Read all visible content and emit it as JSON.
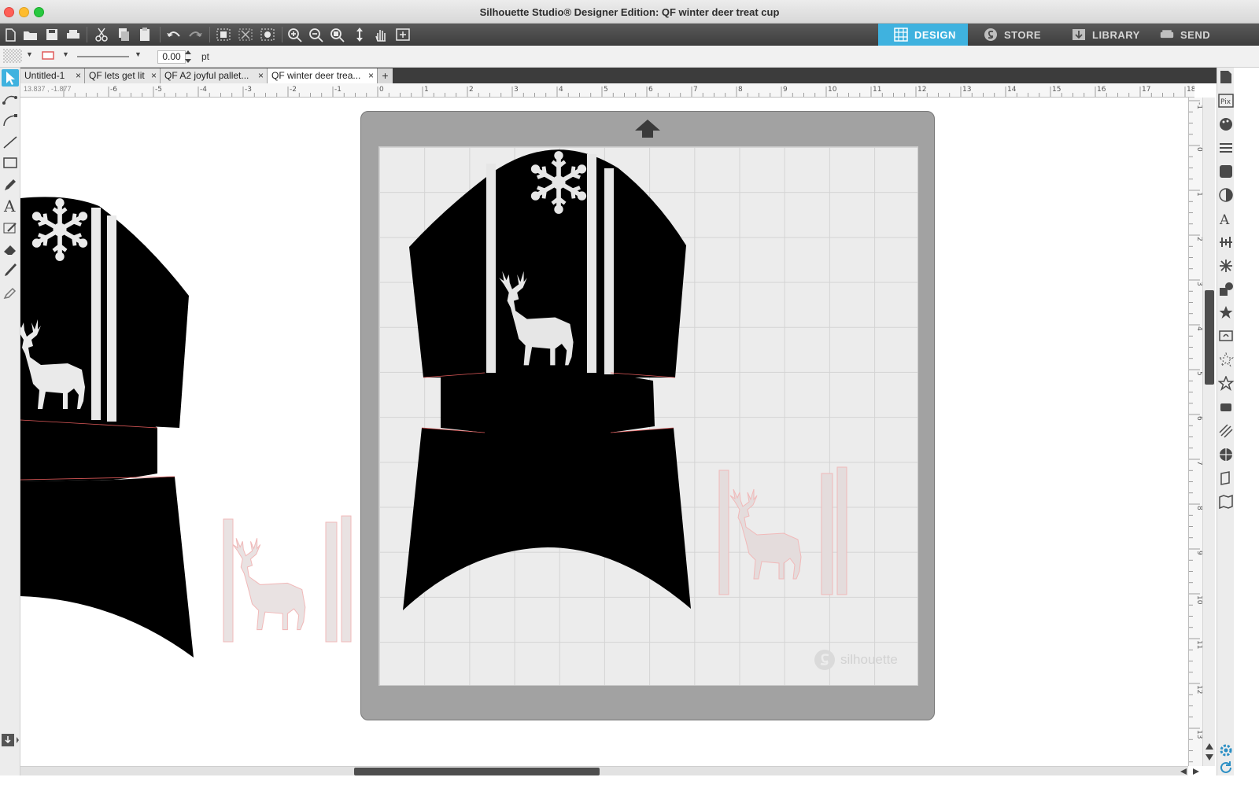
{
  "window": {
    "title": "Silhouette Studio® Designer Edition: QF winter deer treat cup"
  },
  "nav_tabs": [
    {
      "label": "DESIGN",
      "icon": "grid-icon"
    },
    {
      "label": "STORE",
      "icon": "silhouette-s-icon"
    },
    {
      "label": "LIBRARY",
      "icon": "library-download-icon"
    },
    {
      "label": "SEND",
      "icon": "cutter-icon"
    }
  ],
  "properties": {
    "line_width": "0.00",
    "unit": "pt"
  },
  "document_tabs": [
    {
      "label": "Untitled-1",
      "close": "×"
    },
    {
      "label": "QF lets get lit",
      "close": "×"
    },
    {
      "label": "QF  A2 joyful pallet...",
      "close": "×"
    },
    {
      "label": "QF winter deer trea...",
      "close": "×"
    }
  ],
  "tab_add": "+",
  "cursor_coords": "13.837 , -1.877",
  "ruler_h_labels": [
    "-6",
    "-5",
    "-4",
    "-3",
    "-2",
    "-1",
    "0",
    "1",
    "2",
    "3",
    "4",
    "5",
    "6",
    "7",
    "8",
    "9",
    "10",
    "11",
    "12",
    "13",
    "14",
    "15",
    "16",
    "17",
    "18"
  ],
  "ruler_v_labels": [
    "-1",
    "0",
    "1",
    "2",
    "3",
    "4",
    "5",
    "6",
    "7",
    "8",
    "9",
    "10",
    "11",
    "12",
    "13"
  ],
  "mat": {
    "brand": "silhouette"
  },
  "colors": {
    "accent": "#3fb2df",
    "cut_line": "#e05a5a",
    "shape_fill": "#000000"
  }
}
